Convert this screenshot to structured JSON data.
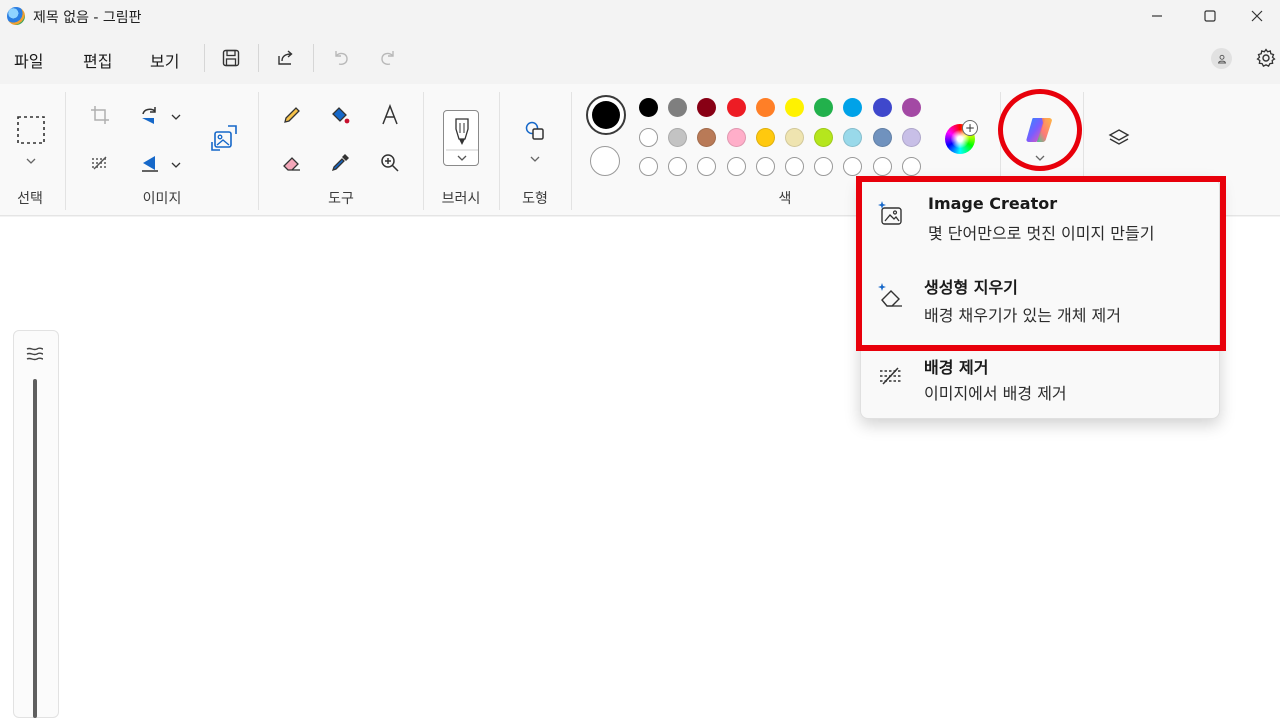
{
  "window": {
    "title": "제목 없음 - 그림판"
  },
  "menu": {
    "file": "파일",
    "edit": "편집",
    "view": "보기"
  },
  "ribbon": {
    "groups": {
      "select": "선택",
      "image": "이미지",
      "tools": "도구",
      "brush": "브러시",
      "shapes": "도형",
      "colors": "색"
    }
  },
  "colors": {
    "primary": "#000000",
    "secondary": "#ffffff",
    "palette_row1": [
      "#000000",
      "#7f7f7f",
      "#880015",
      "#ed1c24",
      "#ff7f27",
      "#fff200",
      "#22b14c",
      "#00a2e8",
      "#3f48cc",
      "#a349a4"
    ],
    "palette_row2": [
      "#ffffff",
      "#c3c3c3",
      "#b97a57",
      "#ffaec9",
      "#ffc90e",
      "#efe4b0",
      "#b5e61d",
      "#99d9ea",
      "#7092be",
      "#c8bfe7"
    ],
    "highlight": "#e8000b"
  },
  "copilot_menu": {
    "items": [
      {
        "title": "Image Creator",
        "desc": "몇 단어만으로 멋진 이미지 만들기",
        "icon": "image-sparkle-icon"
      },
      {
        "title": "생성형 지우기",
        "desc": "배경 채우기가 있는 개체 제거",
        "icon": "eraser-sparkle-icon"
      },
      {
        "title": "배경 제거",
        "desc": "이미지에서 배경 제거",
        "icon": "remove-background-icon"
      }
    ]
  }
}
